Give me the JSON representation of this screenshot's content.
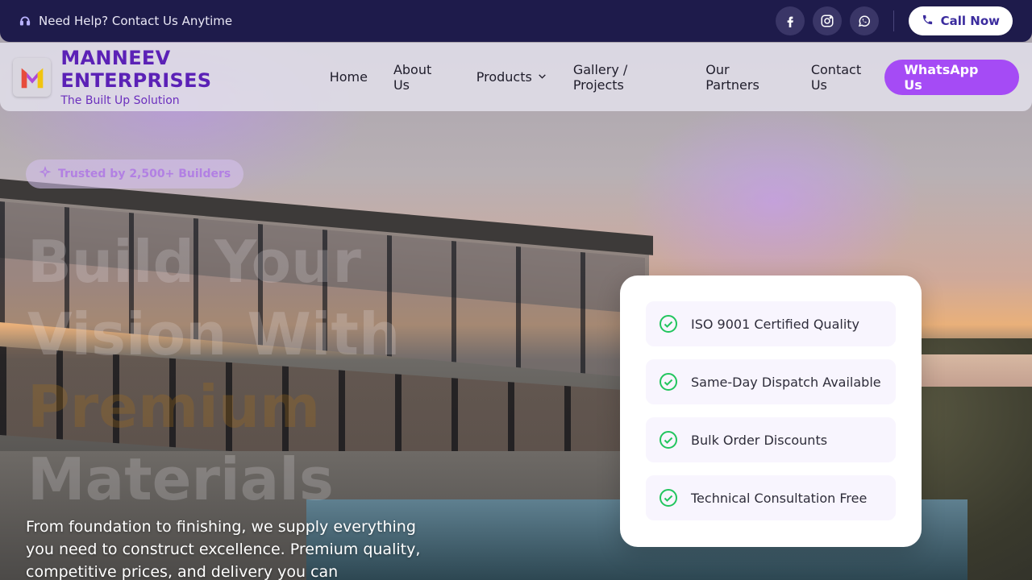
{
  "topbar": {
    "help_text": "Need Help? Contact Us Anytime",
    "social": [
      "facebook-icon",
      "instagram-icon",
      "whatsapp-icon"
    ],
    "call_label": "Call Now"
  },
  "nav": {
    "brand_name": "MANNEEV ENTERPRISES",
    "tagline": "The Built Up Solution",
    "items": [
      {
        "label": "Home"
      },
      {
        "label": "About Us"
      },
      {
        "label": "Products"
      },
      {
        "label": "Gallery / Projects"
      },
      {
        "label": "Our Partners"
      },
      {
        "label": "Contact Us"
      }
    ],
    "whatsapp_label": "WhatsApp Us"
  },
  "hero": {
    "badge": "Trusted by 2,500+ Builders",
    "headline_line1": "Build Your",
    "headline_line2": "Vision With",
    "headline_highlight": "Premium",
    "headline_line4": "Materials",
    "subtitle": "From foundation to finishing, we supply everything you need to construct excellence. Premium quality, competitive prices, and delivery you can"
  },
  "features": [
    {
      "label": "ISO 9001 Certified Quality"
    },
    {
      "label": "Same-Day Dispatch Available"
    },
    {
      "label": "Bulk Order Discounts"
    },
    {
      "label": "Technical Consultation Free"
    }
  ],
  "colors": {
    "topbar": "#1e1b4b",
    "brand": "#5b21b6",
    "accent": "#a54bf5",
    "check": "#22c55e"
  }
}
